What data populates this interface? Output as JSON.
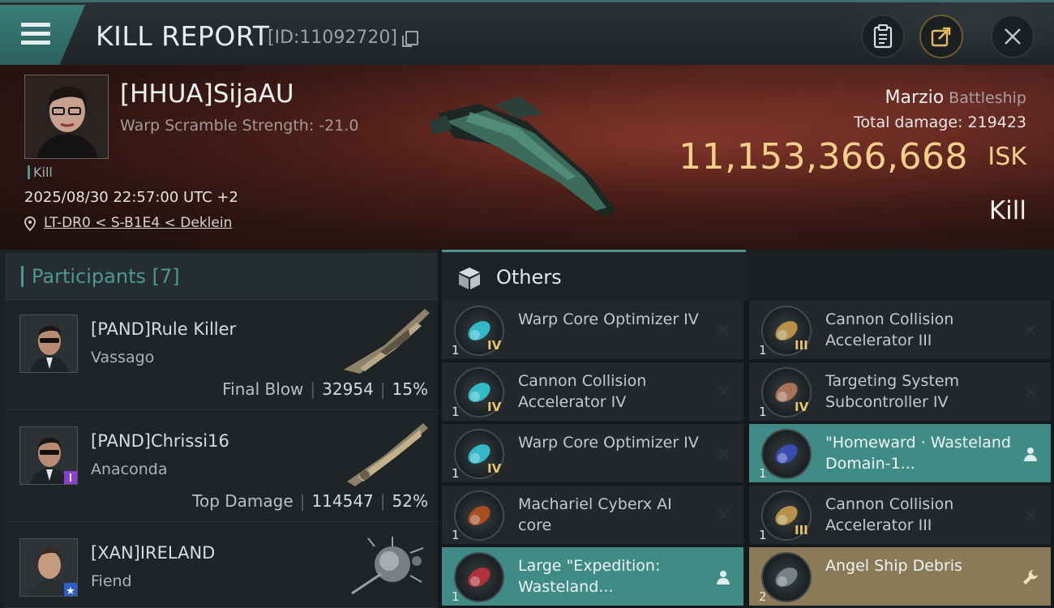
{
  "header": {
    "title": "KILL REPORT",
    "id_text": "[ID:11092720]",
    "icons": [
      "menu-icon",
      "copy-icon",
      "clipboard-icon",
      "external-link-icon",
      "close-icon"
    ]
  },
  "victim": {
    "name": "[HHUA]SijaAU",
    "subtitle": "Warp Scramble Strength: -21.0",
    "tag": "Kill",
    "datetime": "2025/08/30 22:57:00 UTC +2",
    "location": "LT-DR0 < S-B1E4 < Deklein",
    "ship_name": "Marzio",
    "ship_class": "Battleship",
    "total_damage_label": "Total damage:",
    "total_damage_value": "219423",
    "isk_value": "11,153,366,668",
    "isk_unit": "ISK",
    "result": "Kill"
  },
  "participants": {
    "title": "Participants [7]",
    "rows": [
      {
        "name": "[PAND]Rule Killer",
        "ship": "Vassago",
        "stat_label": "Final Blow",
        "damage": "32954",
        "percent": "15%"
      },
      {
        "name": "[PAND]Chrissi16",
        "ship": "Anaconda",
        "stat_label": "Top Damage",
        "damage": "114547",
        "percent": "52%"
      },
      {
        "name": "[XAN]IRELAND",
        "ship": "Fiend",
        "stat_label": "",
        "damage": "",
        "percent": ""
      }
    ]
  },
  "others": {
    "title": "Others",
    "items": [
      {
        "name": "Warp Core Optimizer IV",
        "qty": "1",
        "meta": "IV",
        "action": "close-icon",
        "highlight": "none"
      },
      {
        "name": "Cannon Collision Accelerator III",
        "qty": "1",
        "meta": "III",
        "action": "close-icon",
        "highlight": "none"
      },
      {
        "name": "Cannon Collision Accelerator IV",
        "qty": "1",
        "meta": "IV",
        "action": "close-icon",
        "highlight": "none"
      },
      {
        "name": "Targeting System Subcontroller IV",
        "qty": "1",
        "meta": "IV",
        "action": "close-icon",
        "highlight": "none"
      },
      {
        "name": "Warp Core Optimizer IV",
        "qty": "1",
        "meta": "IV",
        "action": "close-icon",
        "highlight": "none"
      },
      {
        "name": "\"Homeward · Wasteland Domain-1...",
        "qty": "1",
        "meta": "",
        "action": "person-icon",
        "highlight": "teal"
      },
      {
        "name": "Machariel Cyberx AI core",
        "qty": "1",
        "meta": "",
        "action": "close-icon",
        "highlight": "none"
      },
      {
        "name": "Cannon Collision Accelerator III",
        "qty": "1",
        "meta": "III",
        "action": "close-icon",
        "highlight": "none"
      },
      {
        "name": "Large \"Expedition: Wasteland...",
        "qty": "1",
        "meta": "",
        "action": "person-icon",
        "highlight": "teal"
      },
      {
        "name": "Angel Ship Debris",
        "qty": "2",
        "meta": "",
        "action": "wrench-icon",
        "highlight": "gold"
      }
    ]
  },
  "colors": {
    "accent": "#4c9891",
    "isk": "#f4d08a",
    "teal_row": "#3f8c87",
    "gold_row": "#8b7a58"
  }
}
